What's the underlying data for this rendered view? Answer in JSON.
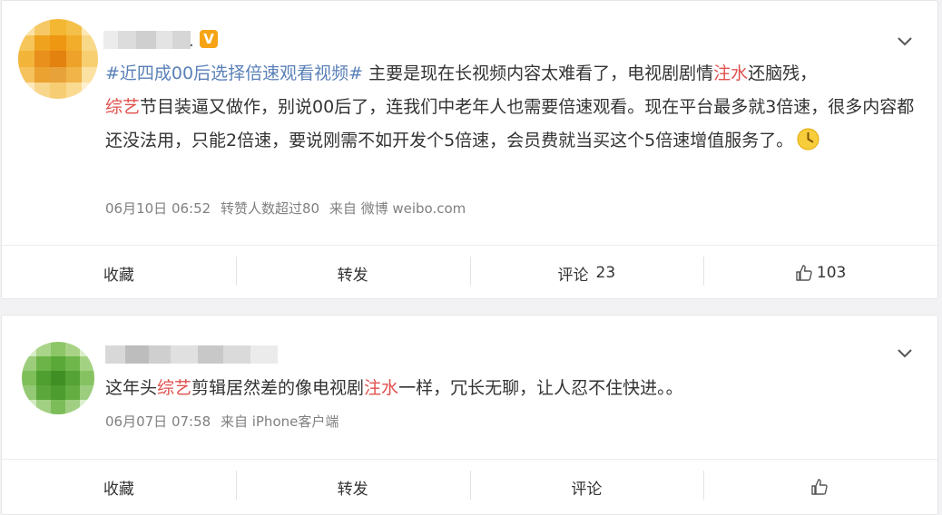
{
  "posts": [
    {
      "vip_badge": "V",
      "name_dot": ".",
      "text": {
        "hashtag": "#近四成00后选择倍速观看视频#",
        "seg1": "主要是现在长视频内容太难看了，电视剧剧情",
        "hl1": "注水",
        "seg2": "还脑残，",
        "hl2": "综艺",
        "seg3": "节目装逼又做作，别说00后了，连我们中老年人也需要倍速观看。现在平台最多就3倍速，很多内容都还没法用，只能2倍速，要说刚需不如开发个5倍速，会员费就当买这个5倍速增值服务了。"
      },
      "emoji_icon": "clock-emoji",
      "meta": {
        "time": "06月10日 06:52",
        "extra": "转赞人数超过80",
        "source": "来自 微博 weibo.com"
      },
      "actions": {
        "favorite": "收藏",
        "repost": "转发",
        "comment": "评论",
        "comment_count": "23",
        "like_count": "103"
      }
    },
    {
      "text": {
        "seg1": "这年头",
        "hl1": "综艺",
        "seg2": "剪辑居然差的像电视剧",
        "hl2": "注水",
        "seg3": "一样，冗长无聊，让人忍不住快进。。"
      },
      "meta": {
        "time": "06月07日 07:58",
        "source": "来自 iPhone客户端"
      },
      "actions": {
        "favorite": "收藏",
        "repost": "转发",
        "comment": "评论",
        "comment_count": "",
        "like_count": ""
      }
    }
  ],
  "colors": {
    "hashtag": "#5a80b8",
    "highlight": "#e0504d",
    "vip": "#f6a415",
    "meta": "#808080"
  }
}
